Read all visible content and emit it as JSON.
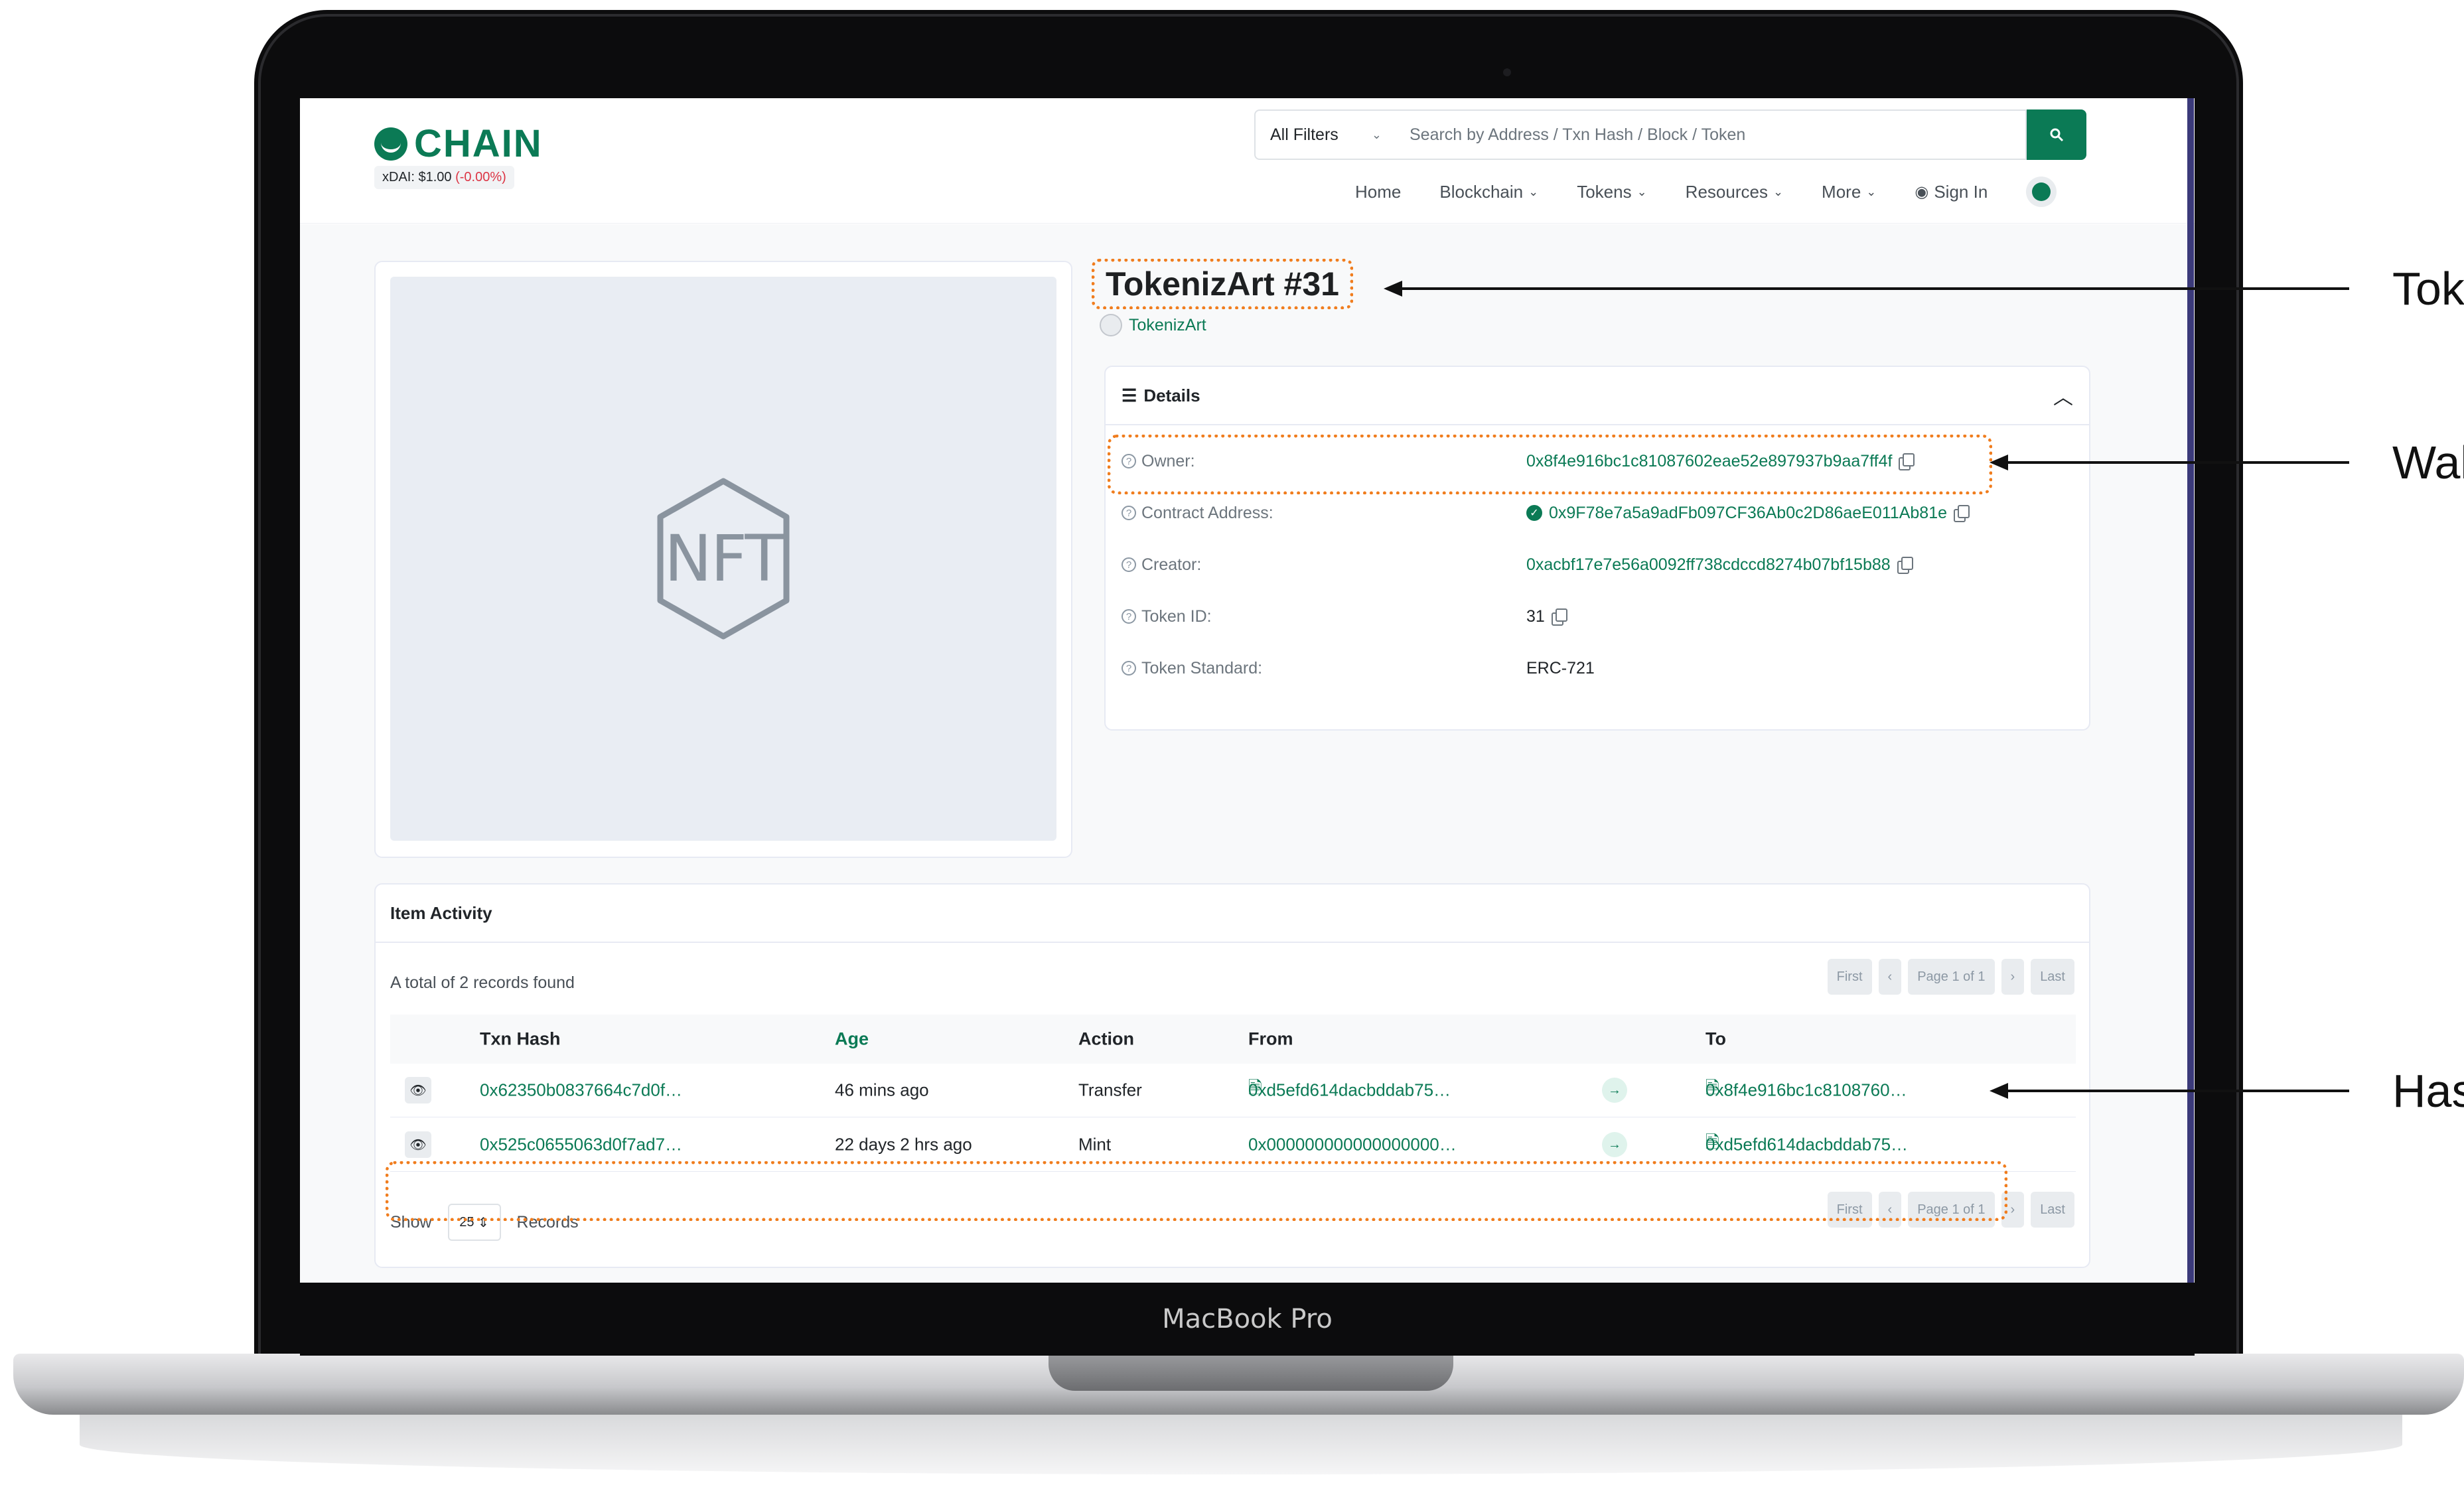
{
  "device": {
    "label": "MacBook Pro"
  },
  "header": {
    "logo_text": "CHAIN",
    "price_label": "xDAI: $1.00",
    "price_change": "(-0.00%)",
    "filter_label": "All Filters",
    "search_placeholder": "Search by Address / Txn Hash / Block / Token",
    "nav": [
      "Home",
      "Blockchain",
      "Tokens",
      "Resources",
      "More",
      "Sign In"
    ]
  },
  "token": {
    "image_placeholder": "NFT",
    "title": "TokenizArt #31",
    "collection": "TokenizArt"
  },
  "details": {
    "heading": "Details",
    "rows": [
      {
        "label": "Owner:",
        "value": "0x8f4e916bc1c81087602eae52e897937b9aa7ff4f"
      },
      {
        "label": "Contract Address:",
        "value": "0x9F78e7a5a9adFb097CF36Ab0c2D86aeE011Ab81e"
      },
      {
        "label": "Creator:",
        "value": "0xacbf17e7e56a0092ff738cdccd8274b07bf15b88"
      },
      {
        "label": "Token ID:",
        "value": "31"
      },
      {
        "label": "Token Standard:",
        "value": "ERC-721"
      }
    ]
  },
  "activity": {
    "heading": "Item Activity",
    "total": "A total of 2 records found",
    "pager": {
      "first": "First",
      "prev": "‹",
      "page": "Page 1 of 1",
      "next": "›",
      "last": "Last"
    },
    "columns": [
      "Txn Hash",
      "Age",
      "Action",
      "From",
      "To"
    ],
    "rows": [
      {
        "hash": "0x62350b0837664c7d0f…",
        "age": "46 mins ago",
        "action": "Transfer",
        "from": "0xd5efd614dacbddab75…",
        "to": "0x8f4e916bc1c8108760…"
      },
      {
        "hash": "0x525c0655063d0f7ad7…",
        "age": "22 days 2 hrs ago",
        "action": "Mint",
        "from": "0x000000000000000000…",
        "to": "0xd5efd614dacbddab75…"
      }
    ],
    "show_label": "Show",
    "page_size": "25",
    "records_label": "Records"
  },
  "annotations": {
    "token": "Toke",
    "wallet": "Wal",
    "hash": "Has"
  },
  "colors": {
    "brand": "#0b7a55",
    "highlight": "#f07d1e"
  }
}
